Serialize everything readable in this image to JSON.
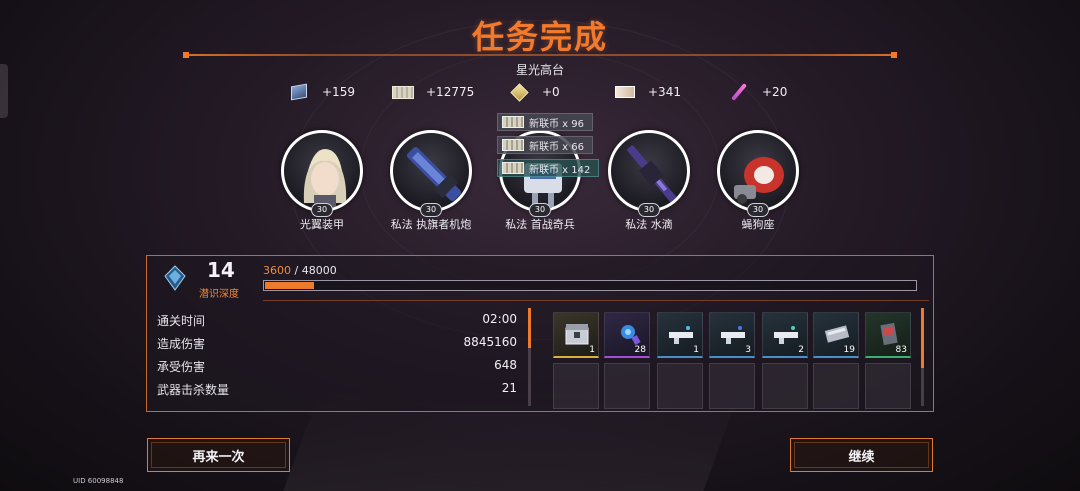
{
  "header": {
    "title": "任务完成",
    "stage_name": "星光高台"
  },
  "rewards": [
    {
      "icon": "crate-icon",
      "value": "+159"
    },
    {
      "icon": "banknote-icon",
      "value": "+12775"
    },
    {
      "icon": "crystal-icon",
      "value": "+0"
    },
    {
      "icon": "ticket-icon",
      "value": "+341"
    },
    {
      "icon": "pink-pen-icon",
      "value": "+20"
    }
  ],
  "popups": [
    {
      "text": "新联币 x 96"
    },
    {
      "text": "新联币 x 66"
    },
    {
      "text": "新联币 x 142"
    }
  ],
  "team": [
    {
      "name": "光翼装甲",
      "level": "30",
      "icon": "blonde-character-portrait"
    },
    {
      "name": "私法 执旗者机炮",
      "level": "30",
      "icon": "cannon-weapon-icon"
    },
    {
      "name": "私法 首战奇兵",
      "level": "30",
      "icon": "robot-gun-icon"
    },
    {
      "name": "私法 水滴",
      "level": "30",
      "icon": "rifle-weapon-icon"
    },
    {
      "name": "蝇狗座",
      "level": "30",
      "icon": "red-mech-icon"
    }
  ],
  "depth": {
    "level": "14",
    "label": "潜识深度",
    "xp_current": "3600",
    "xp_max": "/ 48000",
    "xp_fraction": 0.075
  },
  "stats": [
    {
      "label": "通关时间",
      "value": "02:00"
    },
    {
      "label": "造成伤害",
      "value": "8845160"
    },
    {
      "label": "承受伤害",
      "value": "648"
    },
    {
      "label": "武器击杀数量",
      "value": "21"
    }
  ],
  "loot": [
    {
      "icon": "chest-icon",
      "count": "1",
      "rarity": "gold"
    },
    {
      "icon": "blue-gear-icon",
      "count": "28",
      "rarity": "purple"
    },
    {
      "icon": "gun-blueprint-icon",
      "count": "1",
      "rarity": "blue"
    },
    {
      "icon": "gun-blueprint-icon",
      "count": "3",
      "rarity": "blue"
    },
    {
      "icon": "gun-blueprint-icon",
      "count": "2",
      "rarity": "blue"
    },
    {
      "icon": "metal-plate-icon",
      "count": "19",
      "rarity": "blue"
    },
    {
      "icon": "card-pack-icon",
      "count": "83",
      "rarity": "green"
    }
  ],
  "buttons": {
    "retry": "再来一次",
    "continue": "继续"
  },
  "uid": "UID 60098848",
  "colors": {
    "accent": "#f27a2c",
    "panel_border": "#c9682c"
  }
}
